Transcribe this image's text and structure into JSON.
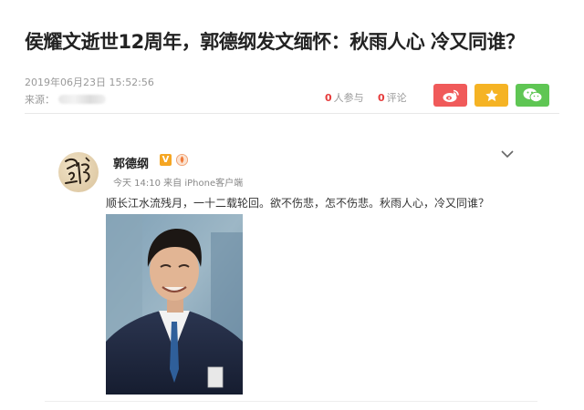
{
  "article": {
    "title": "侯耀文逝世12周年，郭德纲发文缅怀：秋雨人心 冷又同谁？",
    "date": "2019年06月23日 15:52:56",
    "source_label": "来源："
  },
  "stats": {
    "participants_count": "0",
    "participants_label": "人参与",
    "comments_count": "0",
    "comments_label": "评论"
  },
  "share": {
    "weibo_color": "#f05a5a",
    "favorite_color": "#f5b324",
    "wechat_color": "#5fc654"
  },
  "post": {
    "username": "郭德纲",
    "verified_badge": "V",
    "meta": "今天 14:10 来自 iPhone客户端",
    "text": "顺长江水流残月，一十二载轮回。欲不伤悲，怎不伤悲。秋雨人心，冷又同谁？"
  }
}
